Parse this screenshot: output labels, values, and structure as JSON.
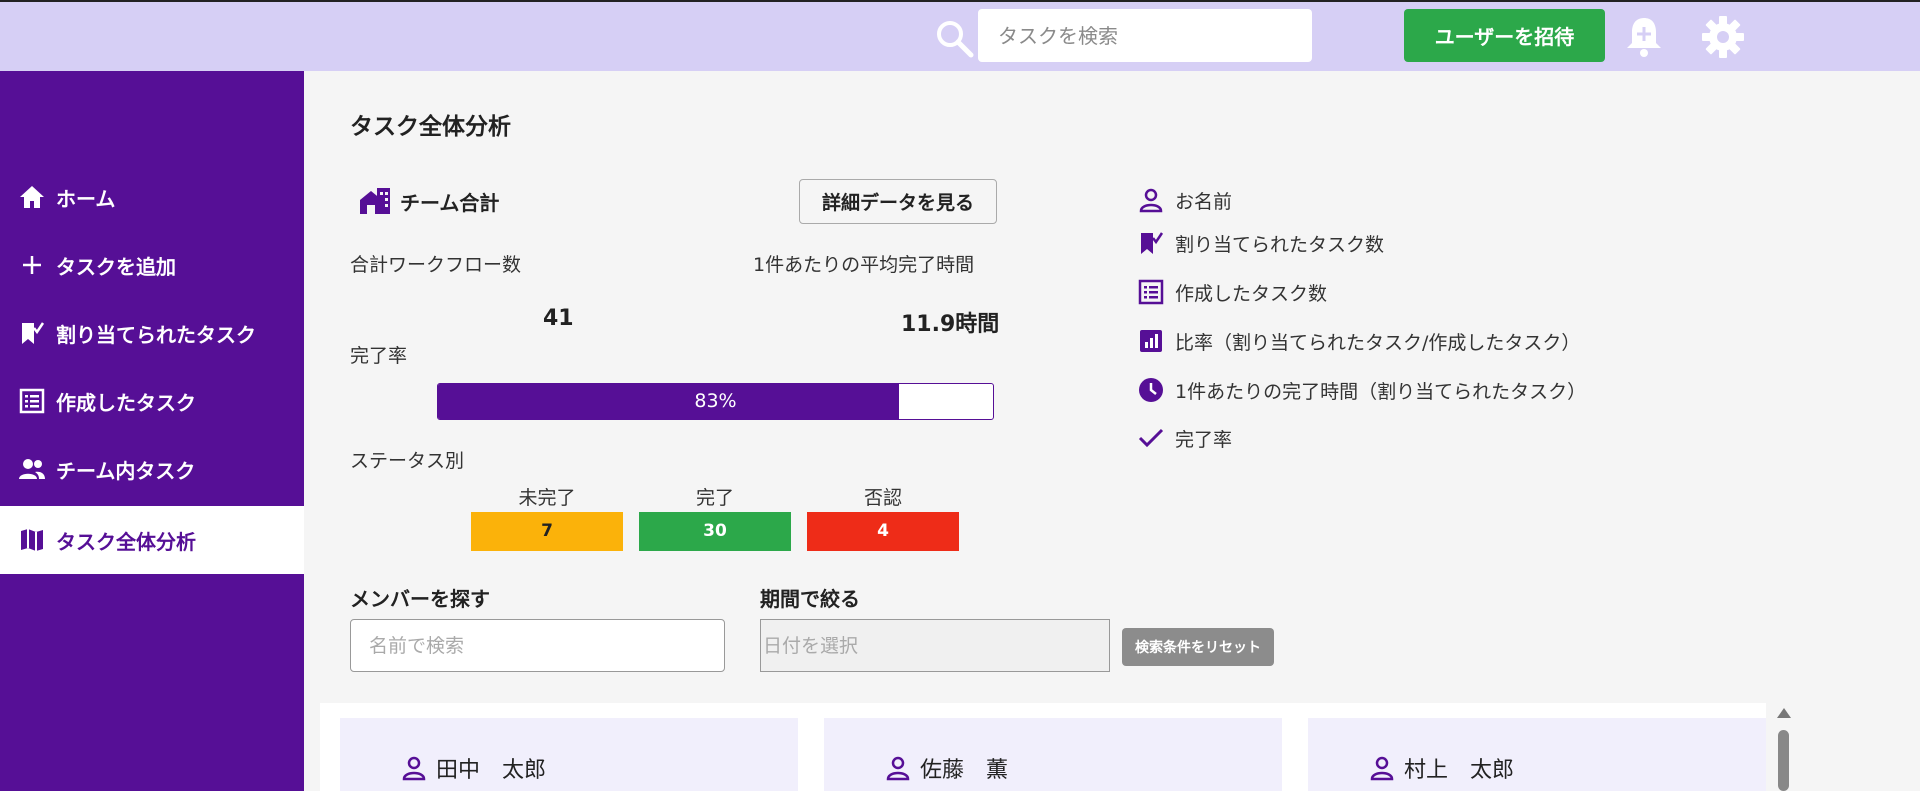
{
  "topbar": {
    "search_placeholder": "タスクを検索",
    "invite_label": "ユーザーを招待",
    "icons": [
      "search-icon",
      "bell-plus-icon",
      "gear-icon"
    ]
  },
  "sidebar": {
    "items": [
      {
        "label": "ホーム",
        "icon": "home-icon"
      },
      {
        "label": "タスクを追加",
        "icon": "plus-icon"
      },
      {
        "label": "割り当てられたタスク",
        "icon": "bookmark-check-icon"
      },
      {
        "label": "作成したタスク",
        "icon": "list-icon"
      },
      {
        "label": "チーム内タスク",
        "icon": "people-icon"
      },
      {
        "label": "タスク全体分析",
        "icon": "map-icon",
        "active": true
      }
    ]
  },
  "main": {
    "title": "タスク全体分析",
    "team_title": "チーム合計",
    "detail_button": "詳細データを見る",
    "total_workflows_label": "合計ワークフロー数",
    "total_workflows_value": "41",
    "avg_time_label": "1件あたりの平均完了時間",
    "avg_time_value": "11.9時間",
    "completion_label": "完了率",
    "completion_value": "83%",
    "completion_fraction": 0.83,
    "status_label": "ステータス別",
    "statuses": [
      {
        "label": "未完了",
        "value": "7",
        "color": "#fbb20a"
      },
      {
        "label": "完了",
        "value": "30",
        "color": "#2ca84a"
      },
      {
        "label": "否認",
        "value": "4",
        "color": "#ee2c18"
      }
    ]
  },
  "legend": {
    "items": [
      {
        "label": "お名前",
        "icon": "person-icon"
      },
      {
        "label": "割り当てられたタスク数",
        "icon": "bookmark-check-icon"
      },
      {
        "label": "作成したタスク数",
        "icon": "list-icon"
      },
      {
        "label": "比率（割り当てられたタスク/作成したタスク）",
        "icon": "bar-chart-icon"
      },
      {
        "label": "1件あたりの完了時間（割り当てられたタスク）",
        "icon": "clock-icon"
      },
      {
        "label": "完了率",
        "icon": "check-icon"
      }
    ]
  },
  "filters": {
    "member_title": "メンバーを探す",
    "member_placeholder": "名前で検索",
    "period_title": "期間で絞る",
    "date_placeholder": "日付を選択",
    "reset_label": "検索条件をリセット"
  },
  "members": [
    {
      "name": "田中　太郎"
    },
    {
      "name": "佐藤　薫"
    },
    {
      "name": "村上　太郎"
    }
  ],
  "colors": {
    "accent": "#560f96",
    "topbar": "#d6cff5",
    "invite": "#2ca84a",
    "card_bg": "#f1effc"
  }
}
